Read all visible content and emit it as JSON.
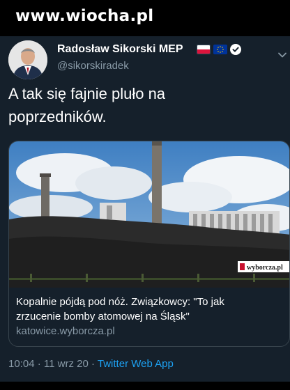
{
  "watermark": "www.wiocha.pl",
  "tweet": {
    "author_name": "Radosław Sikorski MEP",
    "author_handle": "@sikorskiradek",
    "text_line1": "A tak się fajnie pluło na",
    "text_line2": "poprzedników.",
    "time": "10:04",
    "separator": "·",
    "date": "11 wrz 20",
    "source_app": "Twitter Web App"
  },
  "link_card": {
    "image_watermark": "wyborcza.pl",
    "title_line1": "Kopalnie pójdą pod nóż. Związkowcy: \"To jak",
    "title_line2": "zrzucenie bomby atomowej na Śląsk\"",
    "domain": "katowice.wyborcza.pl"
  },
  "icons": {
    "flag_pl": "poland-flag-icon",
    "flag_eu": "eu-flag-icon",
    "verified": "verified-badge-icon",
    "menu": "chevron-down-icon"
  },
  "colors": {
    "background": "#15202b",
    "accent": "#1da1f2",
    "secondary_text": "#8899a6",
    "border": "#38444d"
  }
}
